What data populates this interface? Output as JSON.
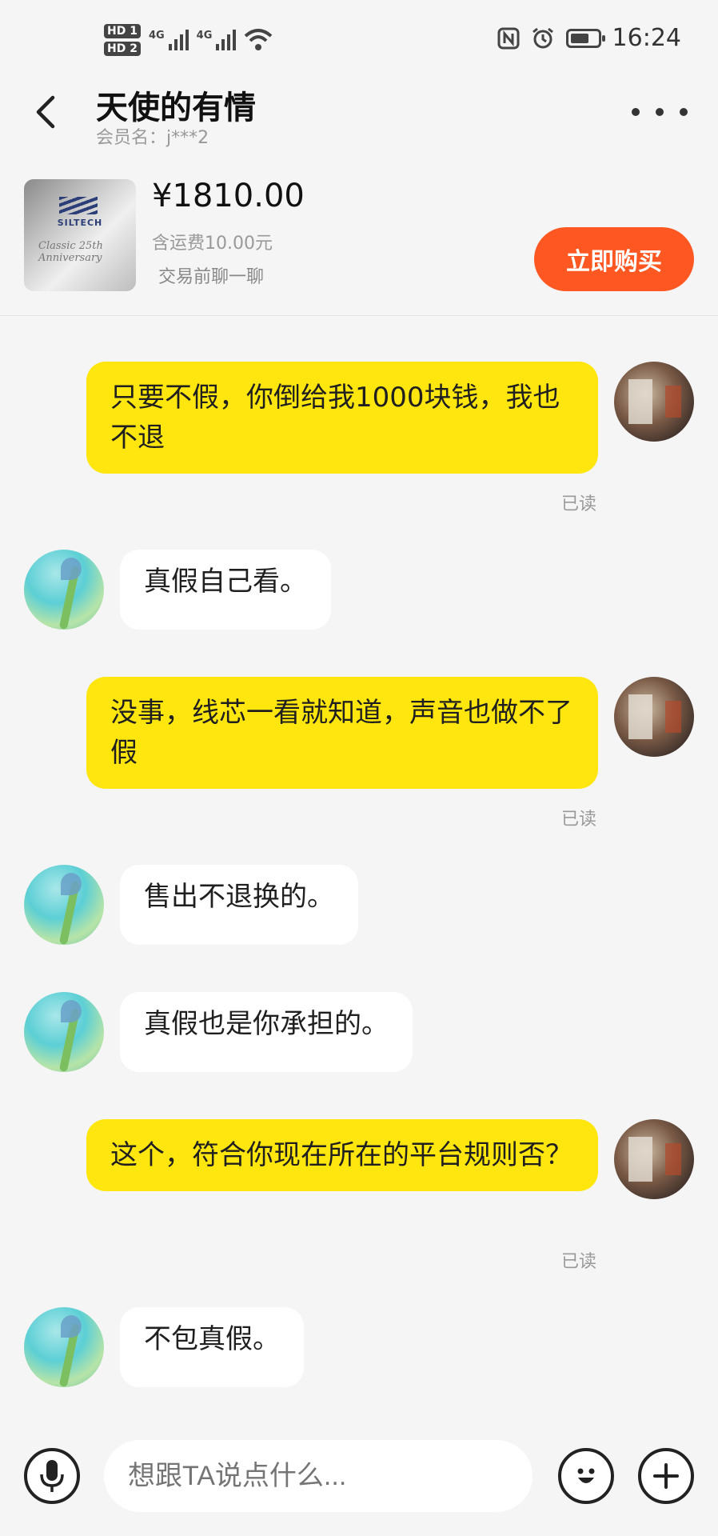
{
  "status_bar": {
    "hd1": "HD 1",
    "hd2": "HD 2",
    "net1": "4G",
    "net2": "4G",
    "time": "16:24",
    "icons": [
      "nfc-icon",
      "alarm-icon",
      "battery-icon",
      "wifi-icon"
    ],
    "battery_level": 0.6
  },
  "header": {
    "title": "天使的有情",
    "subtitle": "会员名：j***2"
  },
  "product": {
    "price": "¥1810.00",
    "shipping": "含运费10.00元",
    "chat_hint": "交易前聊一聊",
    "buy_label": "立即购买",
    "thumb_brand": "SILTECH",
    "thumb_script": "Classic 25th Anniversary"
  },
  "messages": [
    {
      "from": "me",
      "text": "只要不假，你倒给我1000块钱，我也不退",
      "read": "已读"
    },
    {
      "from": "them",
      "text": "真假自己看。"
    },
    {
      "from": "me",
      "text": "没事，线芯一看就知道，声音也做不了假",
      "read": "已读"
    },
    {
      "from": "them",
      "text": "售出不退换的。"
    },
    {
      "from": "them",
      "text": "真假也是你承担的。"
    },
    {
      "from": "me",
      "text": "这个，符合你现在所在的平台规则否？",
      "read": "已读"
    },
    {
      "from": "them",
      "text": "不包真假。"
    }
  ],
  "input": {
    "placeholder": "想跟TA说点什么..."
  },
  "colors": {
    "my_bubble": "#ffe60f",
    "their_bubble": "#ffffff",
    "buy_button": "#ff5722",
    "background": "#f5f5f5"
  }
}
